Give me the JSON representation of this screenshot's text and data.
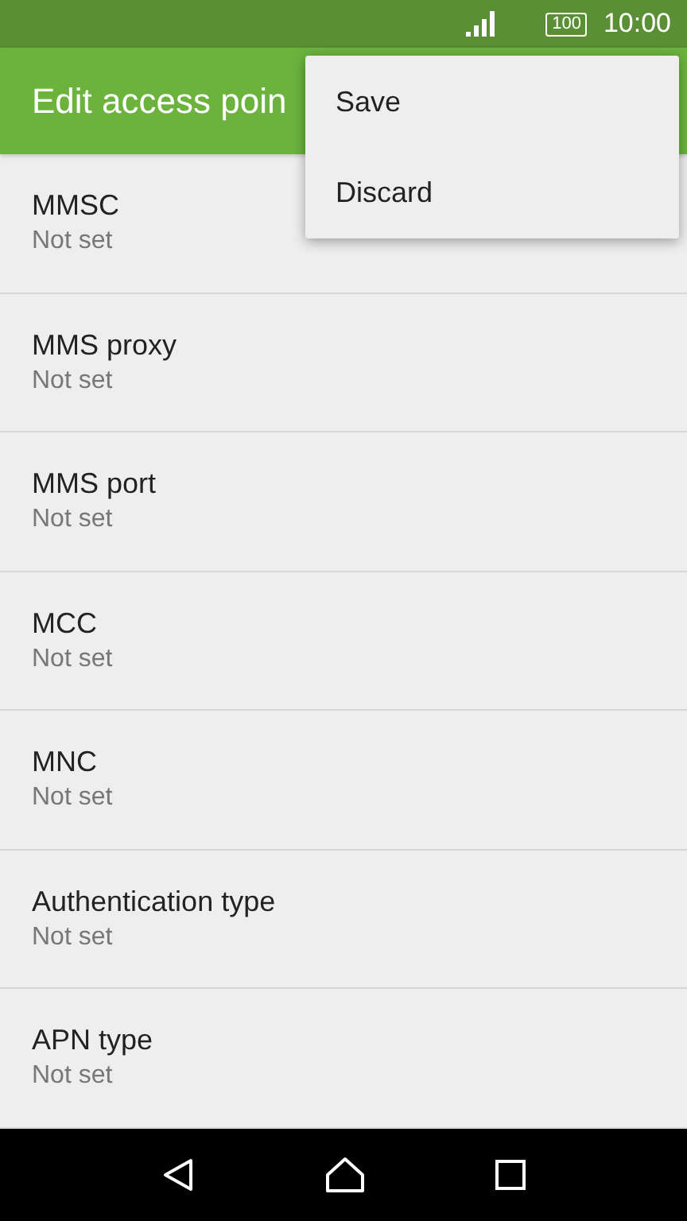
{
  "status_bar": {
    "battery": "100",
    "time": "10:00"
  },
  "app_bar": {
    "title": "Edit access poin"
  },
  "menu": {
    "items": [
      "Save",
      "Discard"
    ]
  },
  "settings": [
    {
      "title": "MMSC",
      "value": "Not set"
    },
    {
      "title": "MMS proxy",
      "value": "Not set"
    },
    {
      "title": "MMS port",
      "value": "Not set"
    },
    {
      "title": "MCC",
      "value": "Not set"
    },
    {
      "title": "MNC",
      "value": "Not set"
    },
    {
      "title": "Authentication type",
      "value": "Not set"
    },
    {
      "title": "APN type",
      "value": "Not set"
    }
  ]
}
